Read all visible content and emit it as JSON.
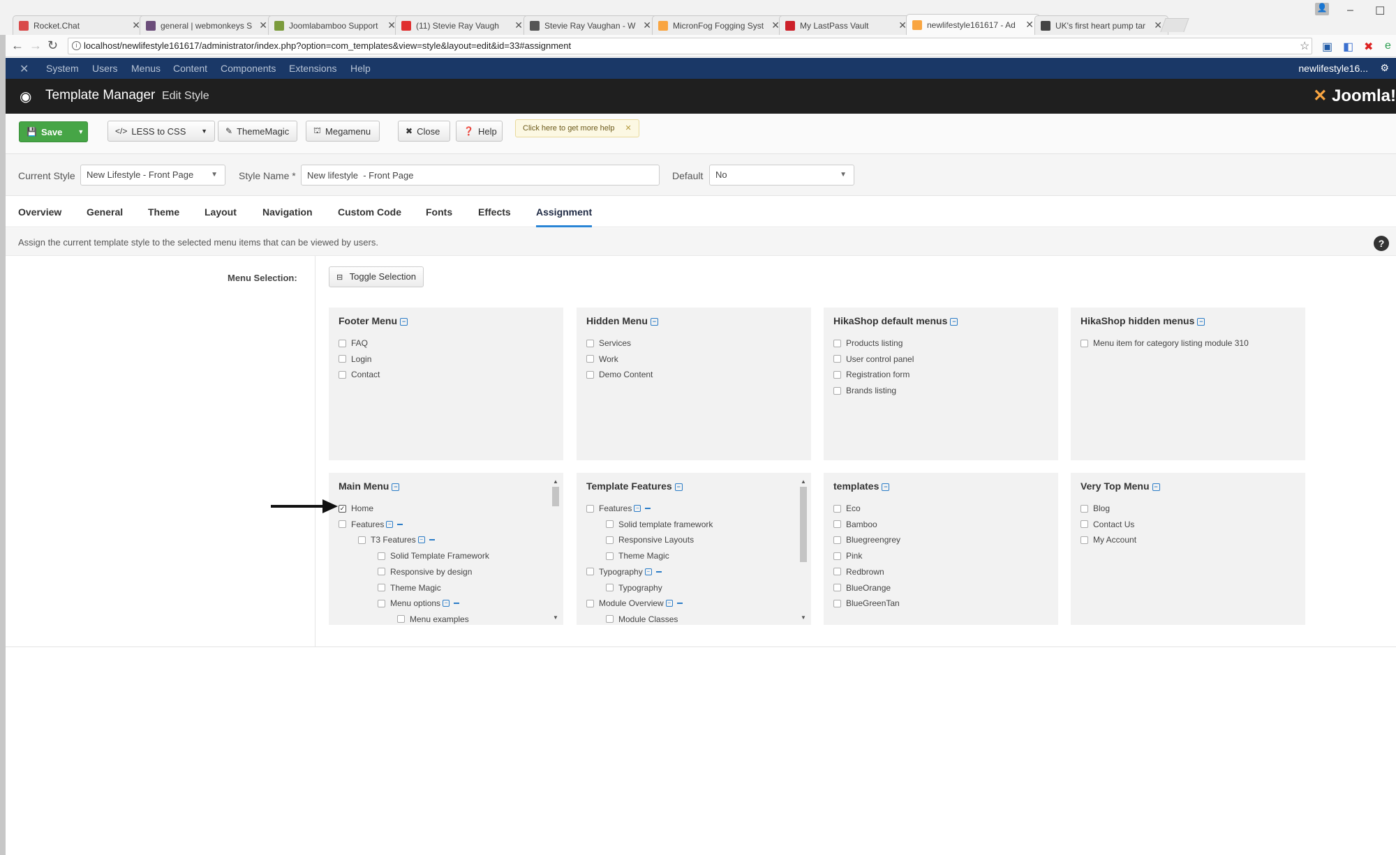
{
  "browser": {
    "tabs": [
      {
        "title": "Rocket.Chat",
        "icon": "rocketchat-icon",
        "color": "#d94a4a"
      },
      {
        "title": "general | webmonkeys S",
        "icon": "slack-icon",
        "color": "#6b4d7a"
      },
      {
        "title": "Joomlabamboo Support",
        "icon": "bamboo-icon",
        "color": "#7b9b3c"
      },
      {
        "title": "(11) Stevie Ray Vaugh",
        "icon": "youtube-icon",
        "color": "#e02f2f"
      },
      {
        "title": "Stevie Ray Vaughan - W",
        "icon": "wikipedia-icon",
        "color": "#555555"
      },
      {
        "title": "MicronFog Fogging Syst",
        "icon": "joomla-icon",
        "color": "#f9a541"
      },
      {
        "title": "My LastPass Vault",
        "icon": "lastpass-icon",
        "color": "#cc2029"
      },
      {
        "title": "newlifestyle161617 - Ad",
        "icon": "joomla-icon",
        "color": "#f9a541"
      },
      {
        "title": "UK's first heart pump tar",
        "icon": "news-icon",
        "color": "#444444"
      }
    ],
    "url": "localhost/newlifestyle161617/administrator/index.php?option=com_templates&view=style&layout=edit&id=33#assignment"
  },
  "topnav": {
    "items": [
      "System",
      "Users",
      "Menus",
      "Content",
      "Components",
      "Extensions",
      "Help"
    ],
    "user": "newlifestyle16..."
  },
  "header": {
    "title": "Template Manager",
    "subtitle": "Edit Style",
    "brand": "Joomla!"
  },
  "toolbar": {
    "save": "Save",
    "less": "LESS to CSS",
    "thememagic": "ThemeMagic",
    "megamenu": "Megamenu",
    "close": "Close",
    "help": "Help",
    "tip": "Click here to get more help"
  },
  "style": {
    "current_label": "Current Style",
    "current_value": "New Lifestyle - Front Page",
    "name_label": "Style Name *",
    "name_value": "New lifestyle  - Front Page",
    "default_label": "Default",
    "default_value": "No"
  },
  "tabs": [
    "Overview",
    "General",
    "Theme",
    "Layout",
    "Navigation",
    "Custom Code",
    "Fonts",
    "Effects",
    "Assignment"
  ],
  "description": "Assign the current template style to the selected menu items that can be viewed by users.",
  "assignment": {
    "menu_selection_label": "Menu Selection:",
    "toggle_label": "Toggle Selection",
    "cards": [
      {
        "title": "Footer Menu",
        "items": [
          {
            "label": "FAQ"
          },
          {
            "label": "Login"
          },
          {
            "label": "Contact"
          }
        ]
      },
      {
        "title": "Hidden Menu",
        "items": [
          {
            "label": "Services"
          },
          {
            "label": "Work"
          },
          {
            "label": "Demo Content"
          }
        ]
      },
      {
        "title": "HikaShop default menus",
        "items": [
          {
            "label": "Products listing"
          },
          {
            "label": "User control panel"
          },
          {
            "label": "Registration form"
          },
          {
            "label": "Brands listing"
          }
        ]
      },
      {
        "title": "HikaShop hidden menus",
        "items": [
          {
            "label": "Menu item for category listing module 310"
          }
        ]
      },
      {
        "title": "Main Menu",
        "items": [
          {
            "label": "Home",
            "checked": true
          },
          {
            "label": "Features",
            "parent": true
          },
          {
            "label": "T3 Features",
            "parent": true
          },
          {
            "label": "Solid Template Framework"
          },
          {
            "label": "Responsive by design"
          },
          {
            "label": "Theme Magic"
          },
          {
            "label": "Menu options",
            "parent": true
          },
          {
            "label": "Menu examples"
          }
        ]
      },
      {
        "title": "Template Features",
        "items": [
          {
            "label": "Features",
            "parent": true
          },
          {
            "label": "Solid template framework"
          },
          {
            "label": "Responsive Layouts"
          },
          {
            "label": "Theme Magic"
          },
          {
            "label": "Typography",
            "parent": true
          },
          {
            "label": "Typography"
          },
          {
            "label": "Module Overview",
            "parent": true
          },
          {
            "label": "Module Classes"
          }
        ]
      },
      {
        "title": "templates",
        "items": [
          {
            "label": "Eco"
          },
          {
            "label": "Bamboo"
          },
          {
            "label": "Bluegreengrey"
          },
          {
            "label": "Pink"
          },
          {
            "label": "Redbrown"
          },
          {
            "label": "BlueOrange"
          },
          {
            "label": "BlueGreenTan"
          }
        ]
      },
      {
        "title": "Very Top Menu",
        "items": [
          {
            "label": "Blog"
          },
          {
            "label": "Contact Us"
          },
          {
            "label": "My Account"
          }
        ]
      }
    ]
  }
}
